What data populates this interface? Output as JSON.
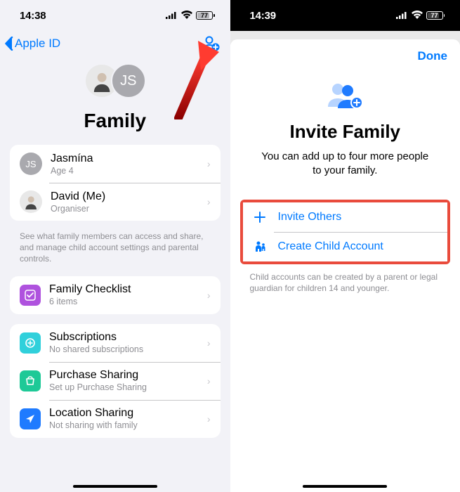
{
  "left": {
    "status": {
      "time": "14:38",
      "battery": "77"
    },
    "nav": {
      "back": "Apple ID"
    },
    "title": "Family",
    "header_avatar_initials": "JS",
    "members": [
      {
        "avatar_type": "initials",
        "initials": "JS",
        "name": "Jasmína",
        "sub": "Age 4"
      },
      {
        "avatar_type": "photo",
        "name": "David (Me)",
        "sub": "Organiser"
      }
    ],
    "members_footer": "See what family members can access and share, and manage child account settings and parental controls.",
    "checklist": {
      "title": "Family Checklist",
      "sub": "6 items",
      "color": "#af52de"
    },
    "settings": [
      {
        "icon": "plus-square",
        "color": "#30d0db",
        "title": "Subscriptions",
        "sub": "No shared subscriptions"
      },
      {
        "icon": "bag",
        "color": "#1ec997",
        "title": "Purchase Sharing",
        "sub": "Set up Purchase Sharing"
      },
      {
        "icon": "location",
        "color": "#1f7bff",
        "title": "Location Sharing",
        "sub": "Not sharing with family"
      }
    ]
  },
  "right": {
    "status": {
      "time": "14:39",
      "battery": "77"
    },
    "done": "Done",
    "title": "Invite Family",
    "subtitle": "You can add up to four more people to your family.",
    "actions": [
      {
        "icon": "plus",
        "label": "Invite Others"
      },
      {
        "icon": "child",
        "label": "Create Child Account"
      }
    ],
    "actions_footer": "Child accounts can be created by a parent or legal guardian for children 14 and younger."
  }
}
